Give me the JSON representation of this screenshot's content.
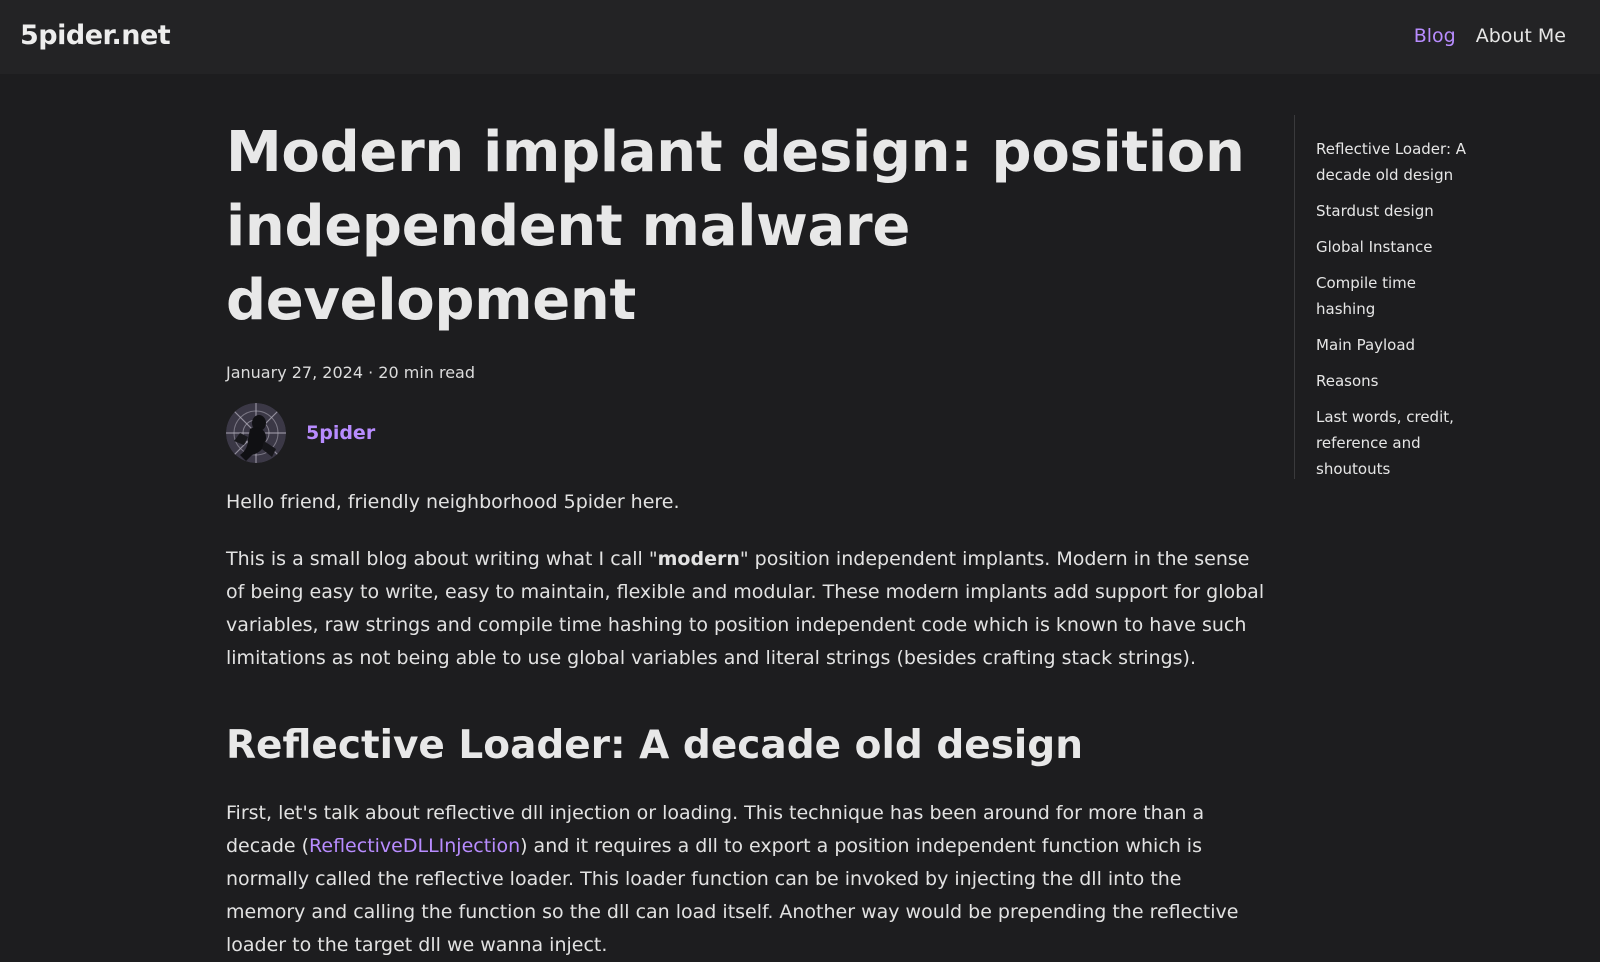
{
  "site": {
    "brand": "5pider.net",
    "nav": [
      {
        "label": "Blog",
        "active": true
      },
      {
        "label": "About Me",
        "active": false
      }
    ]
  },
  "post": {
    "title": "Modern implant design: position independent malware development",
    "date": "January 27, 2024",
    "separator": "·",
    "read_time": "20 min read",
    "author": "5pider",
    "paragraphs": {
      "hello": "Hello friend, friendly neighborhood 5pider here.",
      "intro_before": "This is a small blog about writing what I call \"",
      "intro_bold": "modern",
      "intro_after": "\" position independent implants. Modern in the sense of being easy to write, easy to maintain, flexible and modular. These modern implants add support for global variables, raw strings and compile time hashing to position independent code which is known to have such limitations as not being able to use global variables and literal strings (besides crafting stack strings)."
    },
    "section1": {
      "heading": "Reflective Loader: A decade old design",
      "p1_before": "First, let's talk about reflective dll injection or loading. This technique has been around for more than a decade (",
      "p1_link": "ReflectiveDLLInjection",
      "p1_after": ") and it requires a dll to export a position independent function which is normally called the reflective loader. This loader function can be invoked by injecting the dll into the memory and calling the function so the dll can load itself. Another way would be prepending the reflective loader to the target dll we wanna inject."
    }
  },
  "toc": [
    "Reflective Loader: A decade old design",
    "Stardust design",
    "Global Instance",
    "Compile time hashing",
    "Main Payload",
    "Reasons",
    "Last words, credit, reference and shoutouts"
  ],
  "colors": {
    "accent": "#b88cff",
    "background": "#1d1d1f",
    "navbar": "#232325"
  }
}
